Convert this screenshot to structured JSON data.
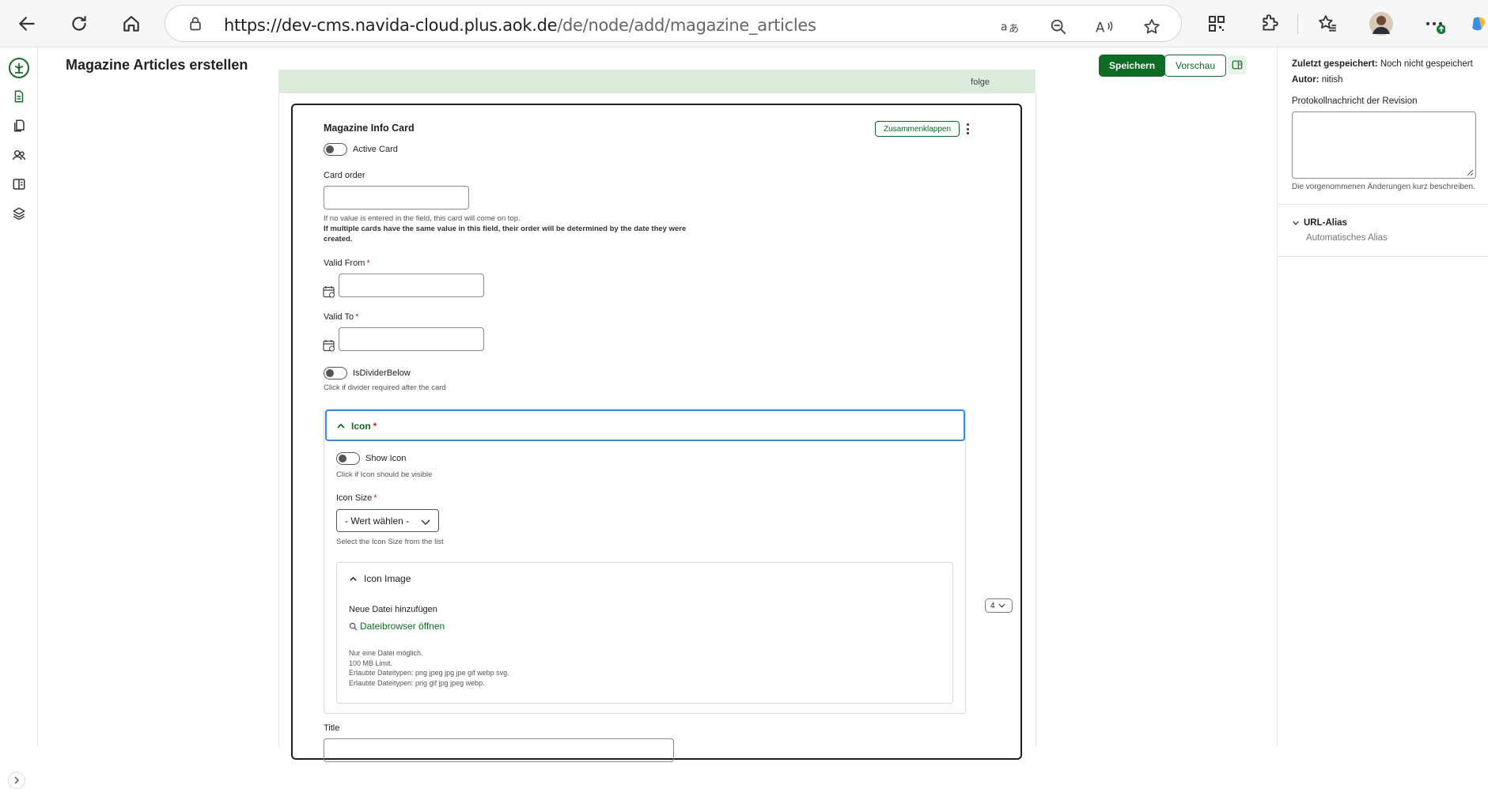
{
  "browser": {
    "url_host": "https://dev-cms.navida-cloud.plus.aok.de",
    "url_path": "/de/node/add/magazine_articles",
    "icons": [
      "back-icon",
      "refresh-icon",
      "home-icon",
      "lock-icon",
      "translate-icon",
      "zoom-out-icon",
      "read-aloud-icon",
      "favorite-star-icon",
      "qr-code-icon",
      "extensions-icon",
      "favorites-icon",
      "profile-avatar",
      "more-icon"
    ]
  },
  "header": {
    "title": "Magazine Articles erstellen",
    "save_label": "Speichern",
    "preview_label": "Vorschau"
  },
  "strip": {
    "text": "folge"
  },
  "card": {
    "title": "Magazine Info Card",
    "collapse_label": "Zusammenklappen",
    "active_card_label": "Active Card",
    "card_order_label": "Card order",
    "card_order_hint_1": "If no value is entered in the field, this card will come on top.",
    "card_order_hint_2": "If multiple cards have the same value in this field, their order will be determined by the date they were created.",
    "valid_from_label": "Valid From",
    "valid_to_label": "Valid To",
    "divider_label": "IsDividerBelow",
    "divider_hint": "Click if divider required after the card",
    "required_mark": "*",
    "title_label": "Title"
  },
  "icon_section": {
    "label": "Icon",
    "show_icon_label": "Show Icon",
    "show_icon_hint": "Click if Icon should be visible",
    "size_label": "Icon Size",
    "size_selected": "- Wert wählen -",
    "size_hint": "Select the Icon Size from the list",
    "image_label": "Icon Image",
    "new_file_label": "Neue Datei hinzufügen",
    "file_browser_label": "Dateibrowser öffnen",
    "file_hint_1": "Nur eine Datei möglich.",
    "file_hint_2": "100 MB Limit.",
    "file_hint_3": "Erlaubte Dateitypen: png jpeg jpg jpe gif webp svg.",
    "file_hint_4": "Erlaubte Dateitypen: png gif jpg jpeg webp."
  },
  "weight": {
    "value": "4"
  },
  "sidebar": {
    "last_saved_label": "Zuletzt gespeichert:",
    "last_saved_value": "Noch nicht gespeichert",
    "author_label": "Autor:",
    "author_value": "nitish",
    "revision_label": "Protokollnachricht der Revision",
    "revision_hint": "Die vorgenommenen Änderungen kurz beschreiben.",
    "url_alias_label": "URL-Alias",
    "url_alias_value": "Automatisches Alias"
  },
  "colors": {
    "primary_green": "#0d6b24",
    "focus_blue": "#3b8bd6",
    "required_red": "#c0262d",
    "strip_green": "#dcebdc"
  }
}
